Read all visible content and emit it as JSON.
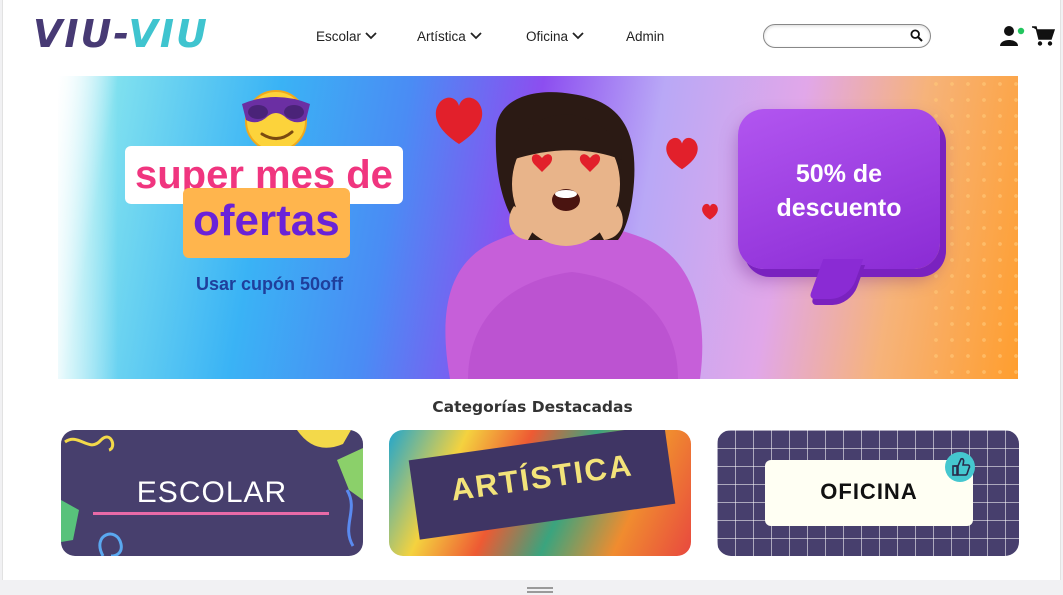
{
  "header": {
    "logo": {
      "part1": "VIU-",
      "part2": "VIU"
    },
    "nav": [
      {
        "label": "Escolar",
        "has_dropdown": true
      },
      {
        "label": "Artística",
        "has_dropdown": true
      },
      {
        "label": "Oficina",
        "has_dropdown": true
      },
      {
        "label": "Admin",
        "has_dropdown": false
      }
    ],
    "search": {
      "placeholder": "",
      "value": "",
      "icon": "search-icon"
    },
    "user_icon": "user-icon",
    "user_status_color": "#22c55e",
    "cart_icon": "cart-icon"
  },
  "banner": {
    "headline_line1": "super mes de",
    "headline_line2": "ofertas",
    "coupon_text": "Usar cupón 50off",
    "bubble_line1": "50% de",
    "bubble_line2": "descuento",
    "colors": {
      "headline1": "#f0357f",
      "headline2": "#6a22d8",
      "highlight": "#ffb54d",
      "bubble": "#9b3ce2"
    }
  },
  "categories": {
    "title": "Categorías Destacadas",
    "items": [
      {
        "label": "ESCOLAR"
      },
      {
        "label": "ARTÍSTICA"
      },
      {
        "label": "OFICINA"
      }
    ]
  }
}
